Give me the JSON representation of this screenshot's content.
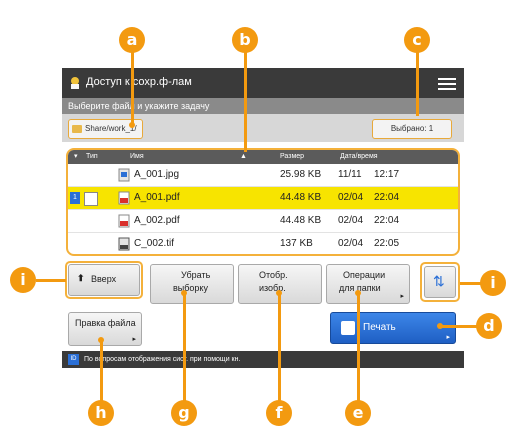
{
  "titlebar": {
    "title": "Доступ к сохр.ф-лам"
  },
  "instruction": "Выберите файл и укажите задачу",
  "path": "Share/work_1/",
  "selected": "Выбрано: 1",
  "table": {
    "columns": [
      "Тип",
      "Имя",
      "Размер",
      "Дата/время"
    ],
    "rows": [
      {
        "name": "A_001.jpg",
        "size": "25.98 KB",
        "date": "11/11",
        "time": "12:17",
        "selected": false,
        "icon": "image-file-icon"
      },
      {
        "name": "A_001.pdf",
        "size": "44.48 KB",
        "date": "02/04",
        "time": "22:04",
        "selected": true,
        "icon": "pdf-file-icon"
      },
      {
        "name": "A_002.pdf",
        "size": "44.48 KB",
        "date": "02/04",
        "time": "22:04",
        "selected": false,
        "icon": "pdf-file-icon"
      },
      {
        "name": "C_002.tif",
        "size": "137 KB",
        "date": "02/04",
        "time": "22:05",
        "selected": false,
        "icon": "tif-file-icon"
      }
    ]
  },
  "buttons": {
    "up": "Вверх",
    "clear_line1": "Убрать",
    "clear_line2": "выборку",
    "display_line1": "Отобр.",
    "display_line2": "изобр.",
    "folder_line1": "Операции",
    "folder_line2": "для папки",
    "print": "Печать",
    "edit": "Правка файла"
  },
  "status": "По вопросам отображения сист. при помощи кн.",
  "callouts": {
    "a": "a",
    "b": "b",
    "c": "c",
    "d": "d",
    "e": "e",
    "f": "f",
    "g": "g",
    "h": "h",
    "i": "i"
  },
  "colors": {
    "callout": "#f39a10",
    "highlight": "#f4b13b",
    "selected_row": "#f7e400",
    "print_button": "#2a6fd6"
  }
}
